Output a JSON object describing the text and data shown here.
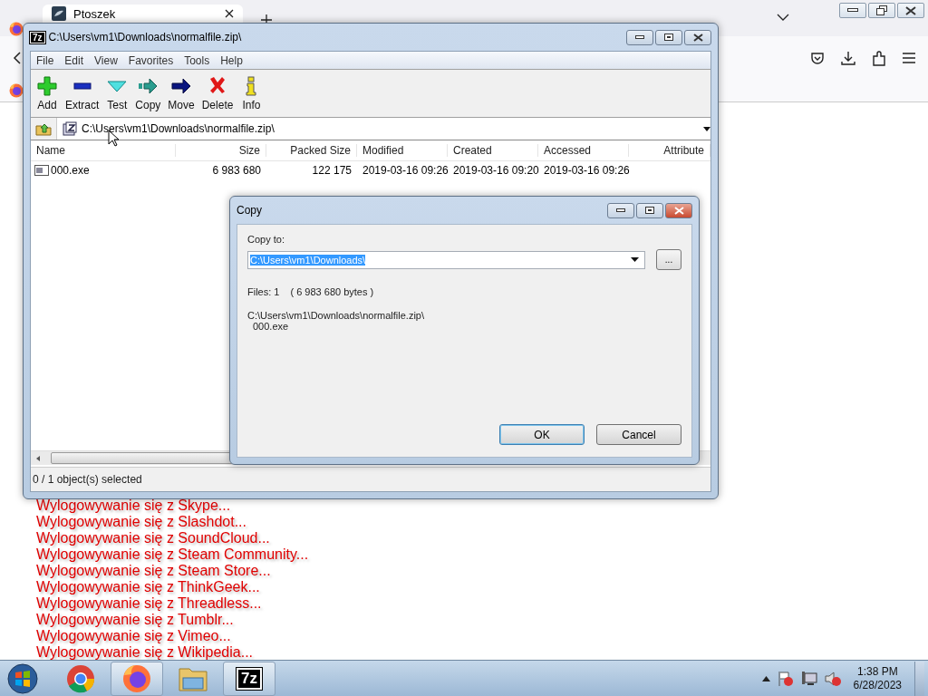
{
  "browser": {
    "tab": {
      "title": "Ptoszek"
    },
    "page_lines": [
      "Wylogowywanie się z Skype...",
      "Wylogowywanie się z Slashdot...",
      "Wylogowywanie się z SoundCloud...",
      "Wylogowywanie się z Steam Community...",
      "Wylogowywanie się z Steam Store...",
      "Wylogowywanie się z ThinkGeek...",
      "Wylogowywanie się z Threadless...",
      "Wylogowywanie się z Tumblr...",
      "Wylogowywanie się z Vimeo...",
      "Wylogowywanie się z Wikipedia..."
    ]
  },
  "archiver": {
    "logo": "7z",
    "title": "C:\\Users\\vm1\\Downloads\\normalfile.zip\\",
    "menu": [
      "File",
      "Edit",
      "View",
      "Favorites",
      "Tools",
      "Help"
    ],
    "toolbar": [
      {
        "label": "Add",
        "kind": "add"
      },
      {
        "label": "Extract",
        "kind": "extract"
      },
      {
        "label": "Test",
        "kind": "test"
      },
      {
        "label": "Copy",
        "kind": "copy"
      },
      {
        "label": "Move",
        "kind": "move"
      },
      {
        "label": "Delete",
        "kind": "delete"
      },
      {
        "label": "Info",
        "kind": "info"
      }
    ],
    "path": "C:\\Users\\vm1\\Downloads\\normalfile.zip\\",
    "columns": [
      "Name",
      "Size",
      "Packed Size",
      "Modified",
      "Created",
      "Accessed",
      "Attribute"
    ],
    "rows": [
      {
        "cells": [
          "000.exe",
          "6 983 680",
          "122 175",
          "2019-03-16 09:26",
          "2019-03-16 09:20",
          "2019-03-16 09:26"
        ]
      }
    ],
    "status": "0 / 1 object(s) selected"
  },
  "dialog": {
    "title": "Copy",
    "label": "Copy to:",
    "destination": {
      "value": "C:\\Users\\vm1\\Downloads\\",
      "selected": true
    },
    "browse": "...",
    "files": "Files: 1",
    "size": "( 6 983 680 bytes )",
    "source": "C:\\Users\\vm1\\Downloads\\normalfile.zip\\",
    "item": "000.exe",
    "buttons": [
      {
        "label": "OK",
        "default": true
      },
      {
        "label": "Cancel",
        "default": false
      }
    ]
  },
  "taskbar": {
    "apps": [
      {
        "kind": "chrome",
        "open": false
      },
      {
        "kind": "firefox",
        "open": true
      },
      {
        "kind": "explorer",
        "open": false
      },
      {
        "kind": "archiver",
        "open": true,
        "label": "7z"
      }
    ],
    "time": "1:38 PM",
    "date": "6/28/2023"
  }
}
